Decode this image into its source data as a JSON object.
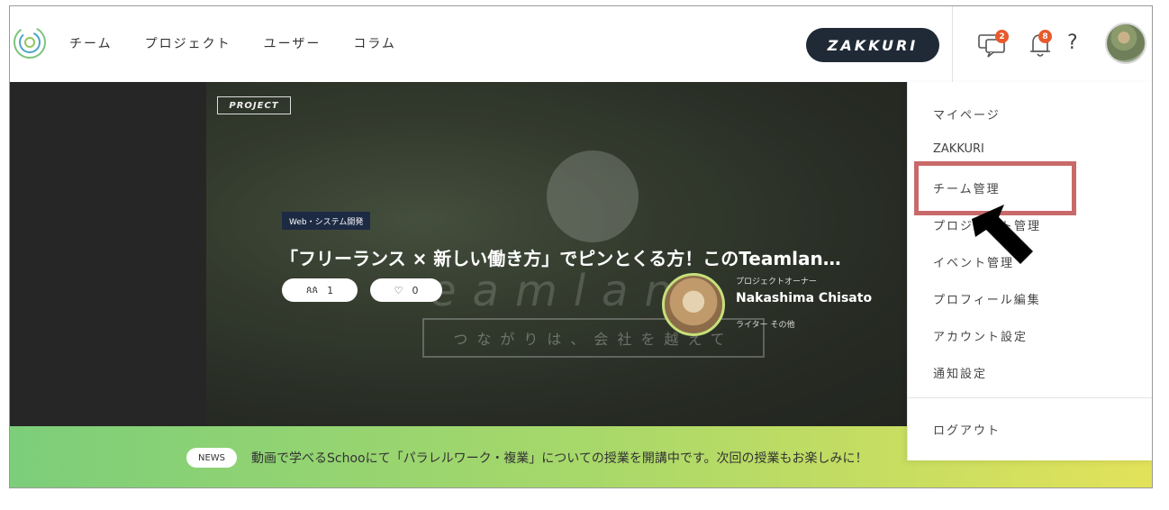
{
  "header": {
    "nav": [
      "チーム",
      "プロジェクト",
      "ユーザー",
      "コラム"
    ],
    "zakkuri_button": "ZAKKURI",
    "messages_badge": "2",
    "notifications_badge": "8",
    "help_label": "?"
  },
  "hero": {
    "tag": "PROJECT",
    "category": "Web・システム開発",
    "title": "「フリーランス × 新しい働き方」でピンとくる方！このTeamlan…",
    "members_count": "1",
    "likes_count": "0",
    "watermark_word": "eamlan",
    "watermark_tagline": "つながりは、会社を越えて",
    "owner_role": "プロジェクトオーナー",
    "owner_name": "Nakashima Chisato",
    "owner_tags": "ライター その他"
  },
  "news": {
    "badge": "NEWS",
    "text": "動画で学べるSchooにて「パラレルワーク・複業」についての授業を開講中です。次回の授業もお楽しみに！"
  },
  "dropdown": {
    "items": [
      "マイページ",
      "ZAKKURI",
      "チーム管理",
      "プロジェクト管理",
      "イベント管理",
      "プロフィール編集",
      "アカウント設定",
      "通知設定"
    ],
    "logout": "ログアウト"
  },
  "colors": {
    "brand_dark": "#1f2a36",
    "badge_orange": "#e85a2c",
    "highlight_red": "#c96a6a"
  }
}
